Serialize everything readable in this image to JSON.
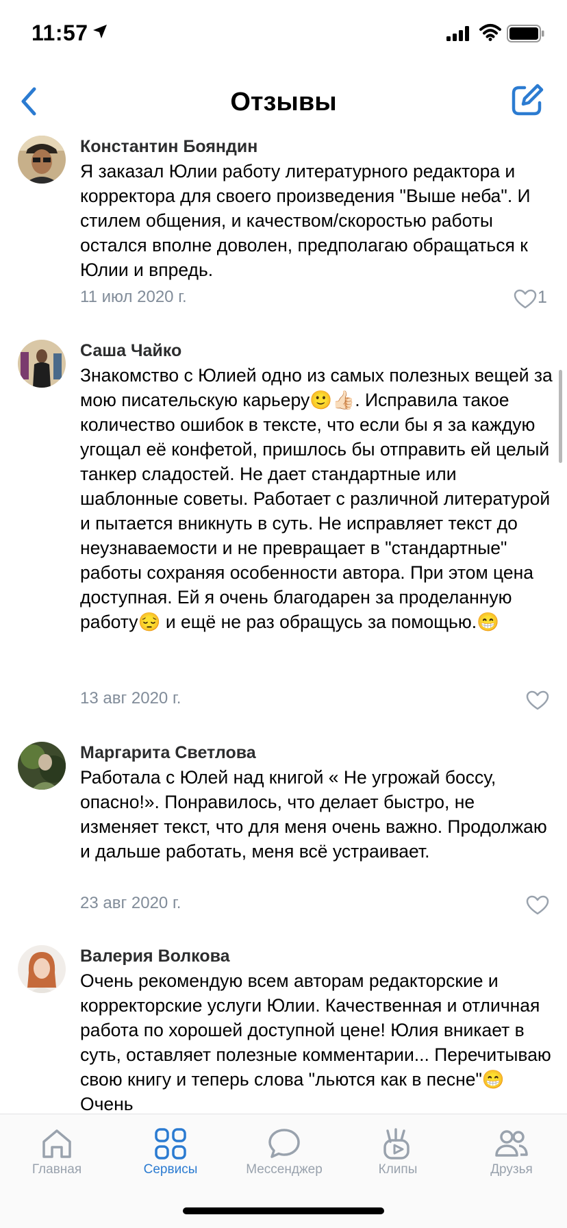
{
  "status_bar": {
    "time": "11:57"
  },
  "nav": {
    "title": "Отзывы"
  },
  "reviews": [
    {
      "name": "Константин Бояндин",
      "text": "Я заказал Юлии работу литературного редактора и корректора для своего произведения \"Выше неба\". И стилем общения, и качеством/скоростью работы остался вполне доволен, предполагаю обращаться к Юлии и впредь.",
      "date": "11 июл 2020 г.",
      "likes": "1"
    },
    {
      "name": "Саша Чайко",
      "text": "Знакомство с Юлией одно из самых полезных вещей за мою писательскую карьеру🙂👍🏻. Исправила такое количество ошибок в тексте, что если бы я за каждую угощал её конфетой, пришлось бы отправить ей целый танкер сладостей. Не дает стандартные или шаблонные советы. Работает с различной литературой и пытается вникнуть в суть. Не исправляет текст до неузнаваемости и не превращает в \"стандартные\" работы сохраняя особенности автора. При этом цена доступная. Ей я очень благодарен за проделанную работу😔 и ещё не раз обращусь за помощью.😁",
      "date": "13 авг 2020 г."
    },
    {
      "name": "Маргарита Светлова",
      "text": "Работала с Юлей над книгой « Не угрожай боссу, опасно!». Понравилось, что делает быстро, не изменяет текст, что для меня очень важно. Продолжаю и дальше работать, меня всё устраивает.",
      "date": "23 авг 2020 г."
    },
    {
      "name": "Валерия Волкова",
      "text": "Очень рекомендую всем авторам редакторские и корректорские услуги Юлии. Качественная и отличная работа по хорошей доступной цене! Юлия вникает в суть, оставляет полезные комментарии... Перечитываю свою книгу и теперь слова \"льются как в песне\"😁 Очень"
    }
  ],
  "tabs": [
    {
      "label": "Главная",
      "icon": "home-icon"
    },
    {
      "label": "Сервисы",
      "icon": "services-icon",
      "active": true
    },
    {
      "label": "Мессенджер",
      "icon": "messenger-icon"
    },
    {
      "label": "Клипы",
      "icon": "clips-icon"
    },
    {
      "label": "Друзья",
      "icon": "friends-icon"
    }
  ],
  "colors": {
    "accent": "#2b7bd1",
    "secondary": "#818c99",
    "tab_inactive": "#99a2ad"
  }
}
